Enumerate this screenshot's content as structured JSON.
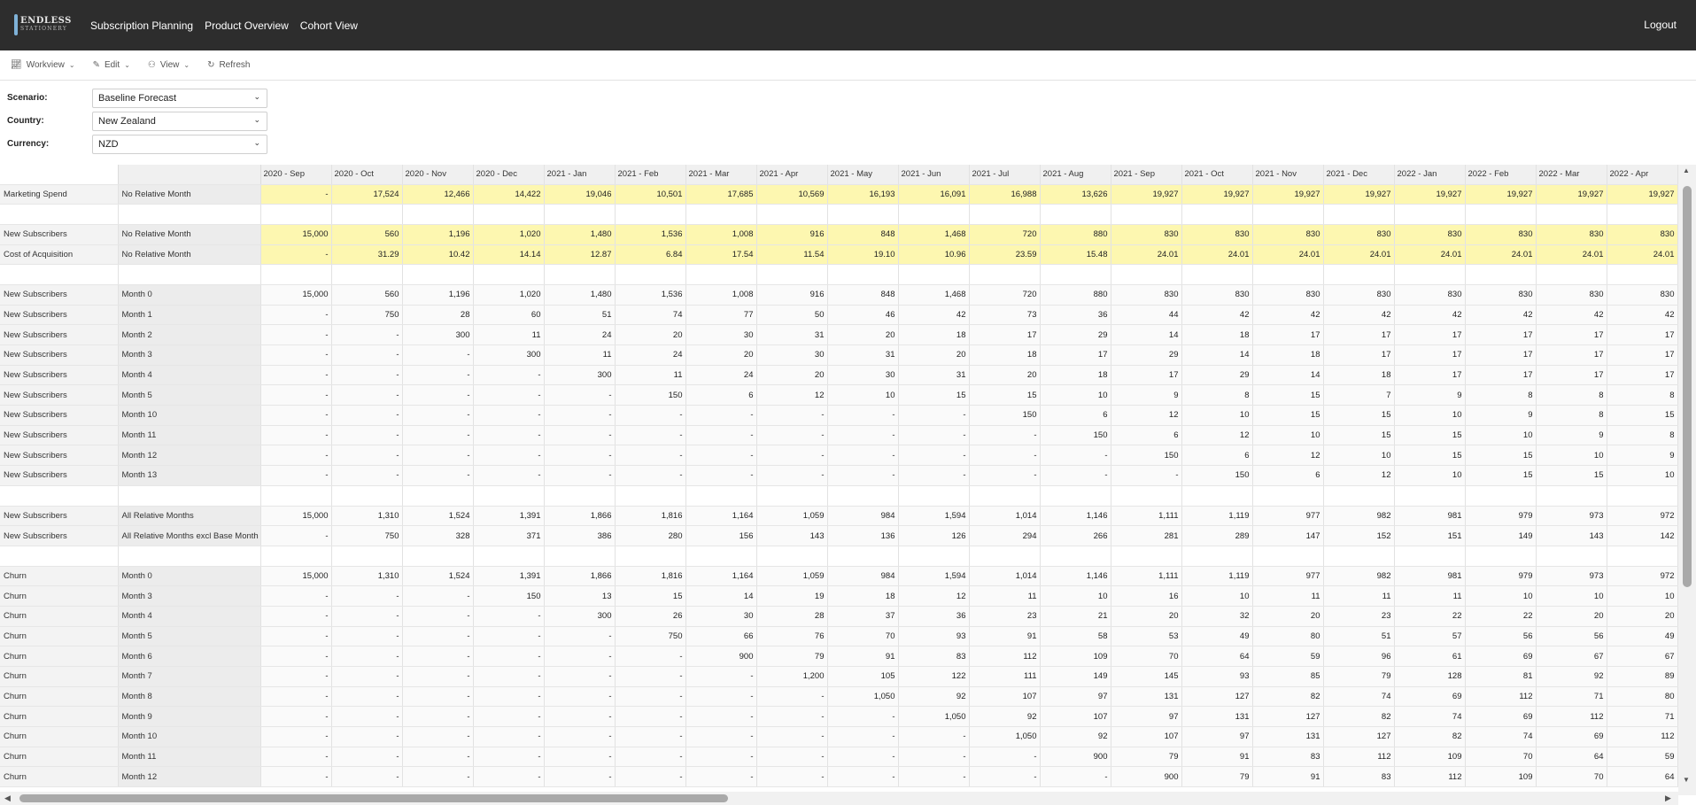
{
  "app": {
    "logo_line1": "ENDLESS",
    "logo_line2": "STATIONERY",
    "nav": [
      "Subscription Planning",
      "Product Overview",
      "Cohort View"
    ],
    "logout": "Logout"
  },
  "toolbar": {
    "workview": "Workview",
    "edit": "Edit",
    "view": "View",
    "refresh": "Refresh"
  },
  "filters": {
    "scenario_label": "Scenario:",
    "scenario_value": "Baseline Forecast",
    "country_label": "Country:",
    "country_value": "New Zealand",
    "currency_label": "Currency:",
    "currency_value": "NZD"
  },
  "grid": {
    "columns": [
      "2020 - Sep",
      "2020 - Oct",
      "2020 - Nov",
      "2020 - Dec",
      "2021 - Jan",
      "2021 - Feb",
      "2021 - Mar",
      "2021 - Apr",
      "2021 - May",
      "2021 - Jun",
      "2021 - Jul",
      "2021 - Aug",
      "2021 - Sep",
      "2021 - Oct",
      "2021 - Nov",
      "2021 - Dec",
      "2022 - Jan",
      "2022 - Feb",
      "2022 - Mar",
      "2022 - Apr"
    ],
    "rows": [
      {
        "type": "hl",
        "a": "Marketing Spend",
        "b": "No Relative Month",
        "v": [
          "-",
          "17,524",
          "12,466",
          "14,422",
          "19,046",
          "10,501",
          "17,685",
          "10,569",
          "16,193",
          "16,091",
          "16,988",
          "13,626",
          "19,927",
          "19,927",
          "19,927",
          "19,927",
          "19,927",
          "19,927",
          "19,927",
          "19,927"
        ]
      },
      {
        "type": "spacer"
      },
      {
        "type": "hl",
        "a": "New Subscribers",
        "b": "No Relative Month",
        "v": [
          "15,000",
          "560",
          "1,196",
          "1,020",
          "1,480",
          "1,536",
          "1,008",
          "916",
          "848",
          "1,468",
          "720",
          "880",
          "830",
          "830",
          "830",
          "830",
          "830",
          "830",
          "830",
          "830"
        ]
      },
      {
        "type": "hl",
        "a": "Cost of Acquisition",
        "b": "No Relative Month",
        "v": [
          "-",
          "31.29",
          "10.42",
          "14.14",
          "12.87",
          "6.84",
          "17.54",
          "11.54",
          "19.10",
          "10.96",
          "23.59",
          "15.48",
          "24.01",
          "24.01",
          "24.01",
          "24.01",
          "24.01",
          "24.01",
          "24.01",
          "24.01"
        ]
      },
      {
        "type": "spacer"
      },
      {
        "type": "norm",
        "a": "New Subscribers",
        "b": "Month 0",
        "v": [
          "15,000",
          "560",
          "1,196",
          "1,020",
          "1,480",
          "1,536",
          "1,008",
          "916",
          "848",
          "1,468",
          "720",
          "880",
          "830",
          "830",
          "830",
          "830",
          "830",
          "830",
          "830",
          "830"
        ]
      },
      {
        "type": "norm",
        "a": "New Subscribers",
        "b": "Month 1",
        "v": [
          "-",
          "750",
          "28",
          "60",
          "51",
          "74",
          "77",
          "50",
          "46",
          "42",
          "73",
          "36",
          "44",
          "42",
          "42",
          "42",
          "42",
          "42",
          "42",
          "42"
        ]
      },
      {
        "type": "norm",
        "a": "New Subscribers",
        "b": "Month 2",
        "v": [
          "-",
          "-",
          "300",
          "11",
          "24",
          "20",
          "30",
          "31",
          "20",
          "18",
          "17",
          "29",
          "14",
          "18",
          "17",
          "17",
          "17",
          "17",
          "17",
          "17"
        ]
      },
      {
        "type": "norm",
        "a": "New Subscribers",
        "b": "Month 3",
        "v": [
          "-",
          "-",
          "-",
          "300",
          "11",
          "24",
          "20",
          "30",
          "31",
          "20",
          "18",
          "17",
          "29",
          "14",
          "18",
          "17",
          "17",
          "17",
          "17",
          "17"
        ]
      },
      {
        "type": "norm",
        "a": "New Subscribers",
        "b": "Month 4",
        "v": [
          "-",
          "-",
          "-",
          "-",
          "300",
          "11",
          "24",
          "20",
          "30",
          "31",
          "20",
          "18",
          "17",
          "29",
          "14",
          "18",
          "17",
          "17",
          "17",
          "17"
        ]
      },
      {
        "type": "norm",
        "a": "New Subscribers",
        "b": "Month 5",
        "v": [
          "-",
          "-",
          "-",
          "-",
          "-",
          "150",
          "6",
          "12",
          "10",
          "15",
          "15",
          "10",
          "9",
          "8",
          "15",
          "7",
          "9",
          "8",
          "8",
          "8"
        ]
      },
      {
        "type": "norm",
        "a": "New Subscribers",
        "b": "Month 10",
        "v": [
          "-",
          "-",
          "-",
          "-",
          "-",
          "-",
          "-",
          "-",
          "-",
          "-",
          "150",
          "6",
          "12",
          "10",
          "15",
          "15",
          "10",
          "9",
          "8",
          "15"
        ]
      },
      {
        "type": "norm",
        "a": "New Subscribers",
        "b": "Month 11",
        "v": [
          "-",
          "-",
          "-",
          "-",
          "-",
          "-",
          "-",
          "-",
          "-",
          "-",
          "-",
          "150",
          "6",
          "12",
          "10",
          "15",
          "15",
          "10",
          "9",
          "8"
        ]
      },
      {
        "type": "norm",
        "a": "New Subscribers",
        "b": "Month 12",
        "v": [
          "-",
          "-",
          "-",
          "-",
          "-",
          "-",
          "-",
          "-",
          "-",
          "-",
          "-",
          "-",
          "150",
          "6",
          "12",
          "10",
          "15",
          "15",
          "10",
          "9"
        ]
      },
      {
        "type": "norm",
        "a": "New Subscribers",
        "b": "Month 13",
        "v": [
          "-",
          "-",
          "-",
          "-",
          "-",
          "-",
          "-",
          "-",
          "-",
          "-",
          "-",
          "-",
          "-",
          "150",
          "6",
          "12",
          "10",
          "15",
          "15",
          "10"
        ]
      },
      {
        "type": "spacer"
      },
      {
        "type": "norm",
        "a": "New Subscribers",
        "b": "All Relative Months",
        "v": [
          "15,000",
          "1,310",
          "1,524",
          "1,391",
          "1,866",
          "1,816",
          "1,164",
          "1,059",
          "984",
          "1,594",
          "1,014",
          "1,146",
          "1,111",
          "1,119",
          "977",
          "982",
          "981",
          "979",
          "973",
          "972"
        ]
      },
      {
        "type": "norm",
        "a": "New Subscribers",
        "b": "All Relative Months excl Base Month",
        "v": [
          "-",
          "750",
          "328",
          "371",
          "386",
          "280",
          "156",
          "143",
          "136",
          "126",
          "294",
          "266",
          "281",
          "289",
          "147",
          "152",
          "151",
          "149",
          "143",
          "142"
        ]
      },
      {
        "type": "spacer"
      },
      {
        "type": "norm",
        "a": "Churn",
        "b": "Month 0",
        "v": [
          "15,000",
          "1,310",
          "1,524",
          "1,391",
          "1,866",
          "1,816",
          "1,164",
          "1,059",
          "984",
          "1,594",
          "1,014",
          "1,146",
          "1,111",
          "1,119",
          "977",
          "982",
          "981",
          "979",
          "973",
          "972"
        ]
      },
      {
        "type": "norm",
        "a": "Churn",
        "b": "Month 3",
        "v": [
          "-",
          "-",
          "-",
          "150",
          "13",
          "15",
          "14",
          "19",
          "18",
          "12",
          "11",
          "10",
          "16",
          "10",
          "11",
          "11",
          "11",
          "10",
          "10",
          "10"
        ]
      },
      {
        "type": "norm",
        "a": "Churn",
        "b": "Month 4",
        "v": [
          "-",
          "-",
          "-",
          "-",
          "300",
          "26",
          "30",
          "28",
          "37",
          "36",
          "23",
          "21",
          "20",
          "32",
          "20",
          "23",
          "22",
          "22",
          "20",
          "20"
        ]
      },
      {
        "type": "norm",
        "a": "Churn",
        "b": "Month 5",
        "v": [
          "-",
          "-",
          "-",
          "-",
          "-",
          "750",
          "66",
          "76",
          "70",
          "93",
          "91",
          "58",
          "53",
          "49",
          "80",
          "51",
          "57",
          "56",
          "56",
          "49"
        ]
      },
      {
        "type": "norm",
        "a": "Churn",
        "b": "Month 6",
        "v": [
          "-",
          "-",
          "-",
          "-",
          "-",
          "-",
          "900",
          "79",
          "91",
          "83",
          "112",
          "109",
          "70",
          "64",
          "59",
          "96",
          "61",
          "69",
          "67",
          "67"
        ]
      },
      {
        "type": "norm",
        "a": "Churn",
        "b": "Month 7",
        "v": [
          "-",
          "-",
          "-",
          "-",
          "-",
          "-",
          "-",
          "1,200",
          "105",
          "122",
          "111",
          "149",
          "145",
          "93",
          "85",
          "79",
          "128",
          "81",
          "92",
          "89"
        ]
      },
      {
        "type": "norm",
        "a": "Churn",
        "b": "Month 8",
        "v": [
          "-",
          "-",
          "-",
          "-",
          "-",
          "-",
          "-",
          "-",
          "1,050",
          "92",
          "107",
          "97",
          "131",
          "127",
          "82",
          "74",
          "69",
          "112",
          "71",
          "80"
        ]
      },
      {
        "type": "norm",
        "a": "Churn",
        "b": "Month 9",
        "v": [
          "-",
          "-",
          "-",
          "-",
          "-",
          "-",
          "-",
          "-",
          "-",
          "1,050",
          "92",
          "107",
          "97",
          "131",
          "127",
          "82",
          "74",
          "69",
          "112",
          "71"
        ]
      },
      {
        "type": "norm",
        "a": "Churn",
        "b": "Month 10",
        "v": [
          "-",
          "-",
          "-",
          "-",
          "-",
          "-",
          "-",
          "-",
          "-",
          "-",
          "1,050",
          "92",
          "107",
          "97",
          "131",
          "127",
          "82",
          "74",
          "69",
          "112"
        ]
      },
      {
        "type": "norm",
        "a": "Churn",
        "b": "Month 11",
        "v": [
          "-",
          "-",
          "-",
          "-",
          "-",
          "-",
          "-",
          "-",
          "-",
          "-",
          "-",
          "900",
          "79",
          "91",
          "83",
          "112",
          "109",
          "70",
          "64",
          "59"
        ]
      },
      {
        "type": "norm",
        "a": "Churn",
        "b": "Month 12",
        "v": [
          "-",
          "-",
          "-",
          "-",
          "-",
          "-",
          "-",
          "-",
          "-",
          "-",
          "-",
          "-",
          "900",
          "79",
          "91",
          "83",
          "112",
          "109",
          "70",
          "64"
        ]
      }
    ]
  }
}
